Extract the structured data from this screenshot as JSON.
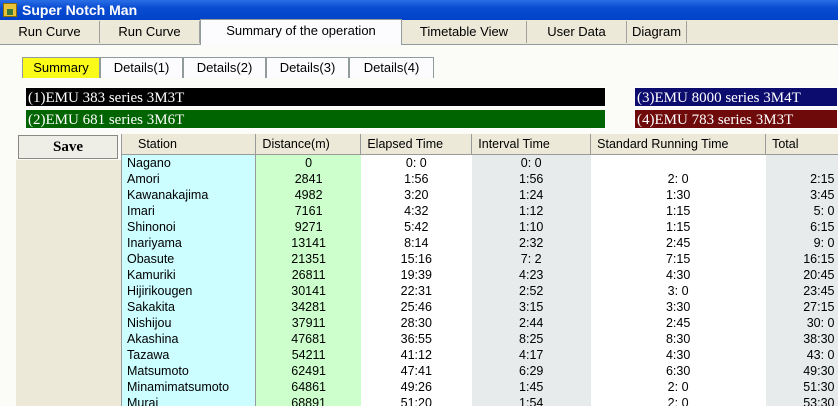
{
  "window": {
    "title": "Super Notch Man",
    "icon": "app-icon"
  },
  "main_tabs": [
    {
      "label": "Run Curve",
      "active": false
    },
    {
      "label": "Run Curve",
      "active": false
    },
    {
      "label": "Summary of the operation",
      "active": true
    },
    {
      "label": "Timetable View",
      "active": false
    },
    {
      "label": "User Data",
      "active": false
    },
    {
      "label": "Diagram",
      "active": false
    }
  ],
  "sub_tabs": [
    {
      "label": "Summary",
      "active": true
    },
    {
      "label": "Details(1)",
      "active": false
    },
    {
      "label": "Details(2)",
      "active": false
    },
    {
      "label": "Details(3)",
      "active": false
    },
    {
      "label": "Details(4)",
      "active": false
    }
  ],
  "trains": [
    {
      "label": "(1)EMU 383 series  3M3T",
      "color": "#000000"
    },
    {
      "label": "(2)EMU 681 series  3M6T",
      "color": "#006400"
    },
    {
      "label": "(3)EMU 8000 series  3M4T",
      "color": "#0c0c6e"
    },
    {
      "label": "(4)EMU 783 series  3M3T",
      "color": "#6e0a0a"
    }
  ],
  "save_label": "Save",
  "table": {
    "columns": [
      "Station",
      "Distance(m)",
      "Elapsed Time",
      "Interval Time",
      "Standard Running Time",
      "Total"
    ],
    "rows": [
      [
        "Nagano",
        "0",
        "0: 0",
        "0: 0",
        "",
        ""
      ],
      [
        "Amori",
        "2841",
        "1:56",
        "1:56",
        "2: 0",
        "2:15"
      ],
      [
        "Kawanakajima",
        "4982",
        "3:20",
        "1:24",
        "1:30",
        "3:45"
      ],
      [
        "Imari",
        "7161",
        "4:32",
        "1:12",
        "1:15",
        "5: 0"
      ],
      [
        "Shinonoi",
        "9271",
        "5:42",
        "1:10",
        "1:15",
        "6:15"
      ],
      [
        "Inariyama",
        "13141",
        "8:14",
        "2:32",
        "2:45",
        "9: 0"
      ],
      [
        "Obasute",
        "21351",
        "15:16",
        "7: 2",
        "7:15",
        "16:15"
      ],
      [
        "Kamuriki",
        "26811",
        "19:39",
        "4:23",
        "4:30",
        "20:45"
      ],
      [
        "Hijirikougen",
        "30141",
        "22:31",
        "2:52",
        "3: 0",
        "23:45"
      ],
      [
        "Sakakita",
        "34281",
        "25:46",
        "3:15",
        "3:30",
        "27:15"
      ],
      [
        "Nishijou",
        "37911",
        "28:30",
        "2:44",
        "2:45",
        "30: 0"
      ],
      [
        "Akashina",
        "47681",
        "36:55",
        "8:25",
        "8:30",
        "38:30"
      ],
      [
        "Tazawa",
        "54211",
        "41:12",
        "4:17",
        "4:30",
        "43: 0"
      ],
      [
        "Matsumoto",
        "62491",
        "47:41",
        "6:29",
        "6:30",
        "49:30"
      ],
      [
        "Minamimatsumoto",
        "64861",
        "49:26",
        "1:45",
        "2: 0",
        "51:30"
      ],
      [
        "Murai",
        "68891",
        "51:20",
        "1:54",
        "2: 0",
        "53:30"
      ]
    ]
  }
}
